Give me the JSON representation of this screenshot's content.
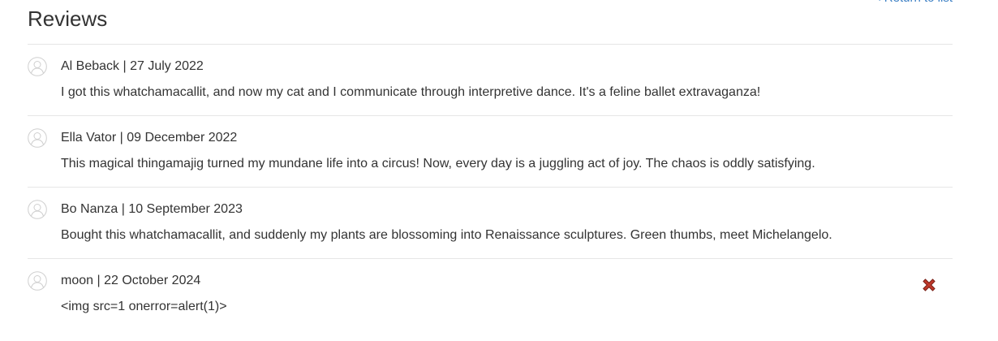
{
  "header": {
    "title": "Reviews",
    "return_link": "< Return to list"
  },
  "reviews": [
    {
      "author": "Al Beback",
      "date": "27 July 2022",
      "meta": "Al Beback | 27 July 2022",
      "text": "I got this whatchamacallit, and now my cat and I communicate through interpretive dance. It's a feline ballet extravaganza!"
    },
    {
      "author": "Ella Vator",
      "date": "09 December 2022",
      "meta": "Ella Vator | 09 December 2022",
      "text": "This magical thingamajig turned my mundane life into a circus! Now, every day is a juggling act of joy. The chaos is oddly satisfying."
    },
    {
      "author": "Bo Nanza",
      "date": "10 September 2023",
      "meta": "Bo Nanza | 10 September 2023",
      "text": "Bought this whatchamacallit, and suddenly my plants are blossoming into Renaissance sculptures. Green thumbs, meet Michelangelo."
    },
    {
      "author": "moon",
      "date": "22 October 2024",
      "meta": "moon | 22 October 2024",
      "text": "<img src=1 onerror=alert(1)>",
      "deletable": true
    }
  ],
  "icons": {
    "avatar": "user-avatar-icon",
    "delete": "delete-icon"
  },
  "colors": {
    "link": "#3b7fc4",
    "delete": "#c0392b",
    "divider": "#e6e6e6",
    "text": "#333333"
  }
}
